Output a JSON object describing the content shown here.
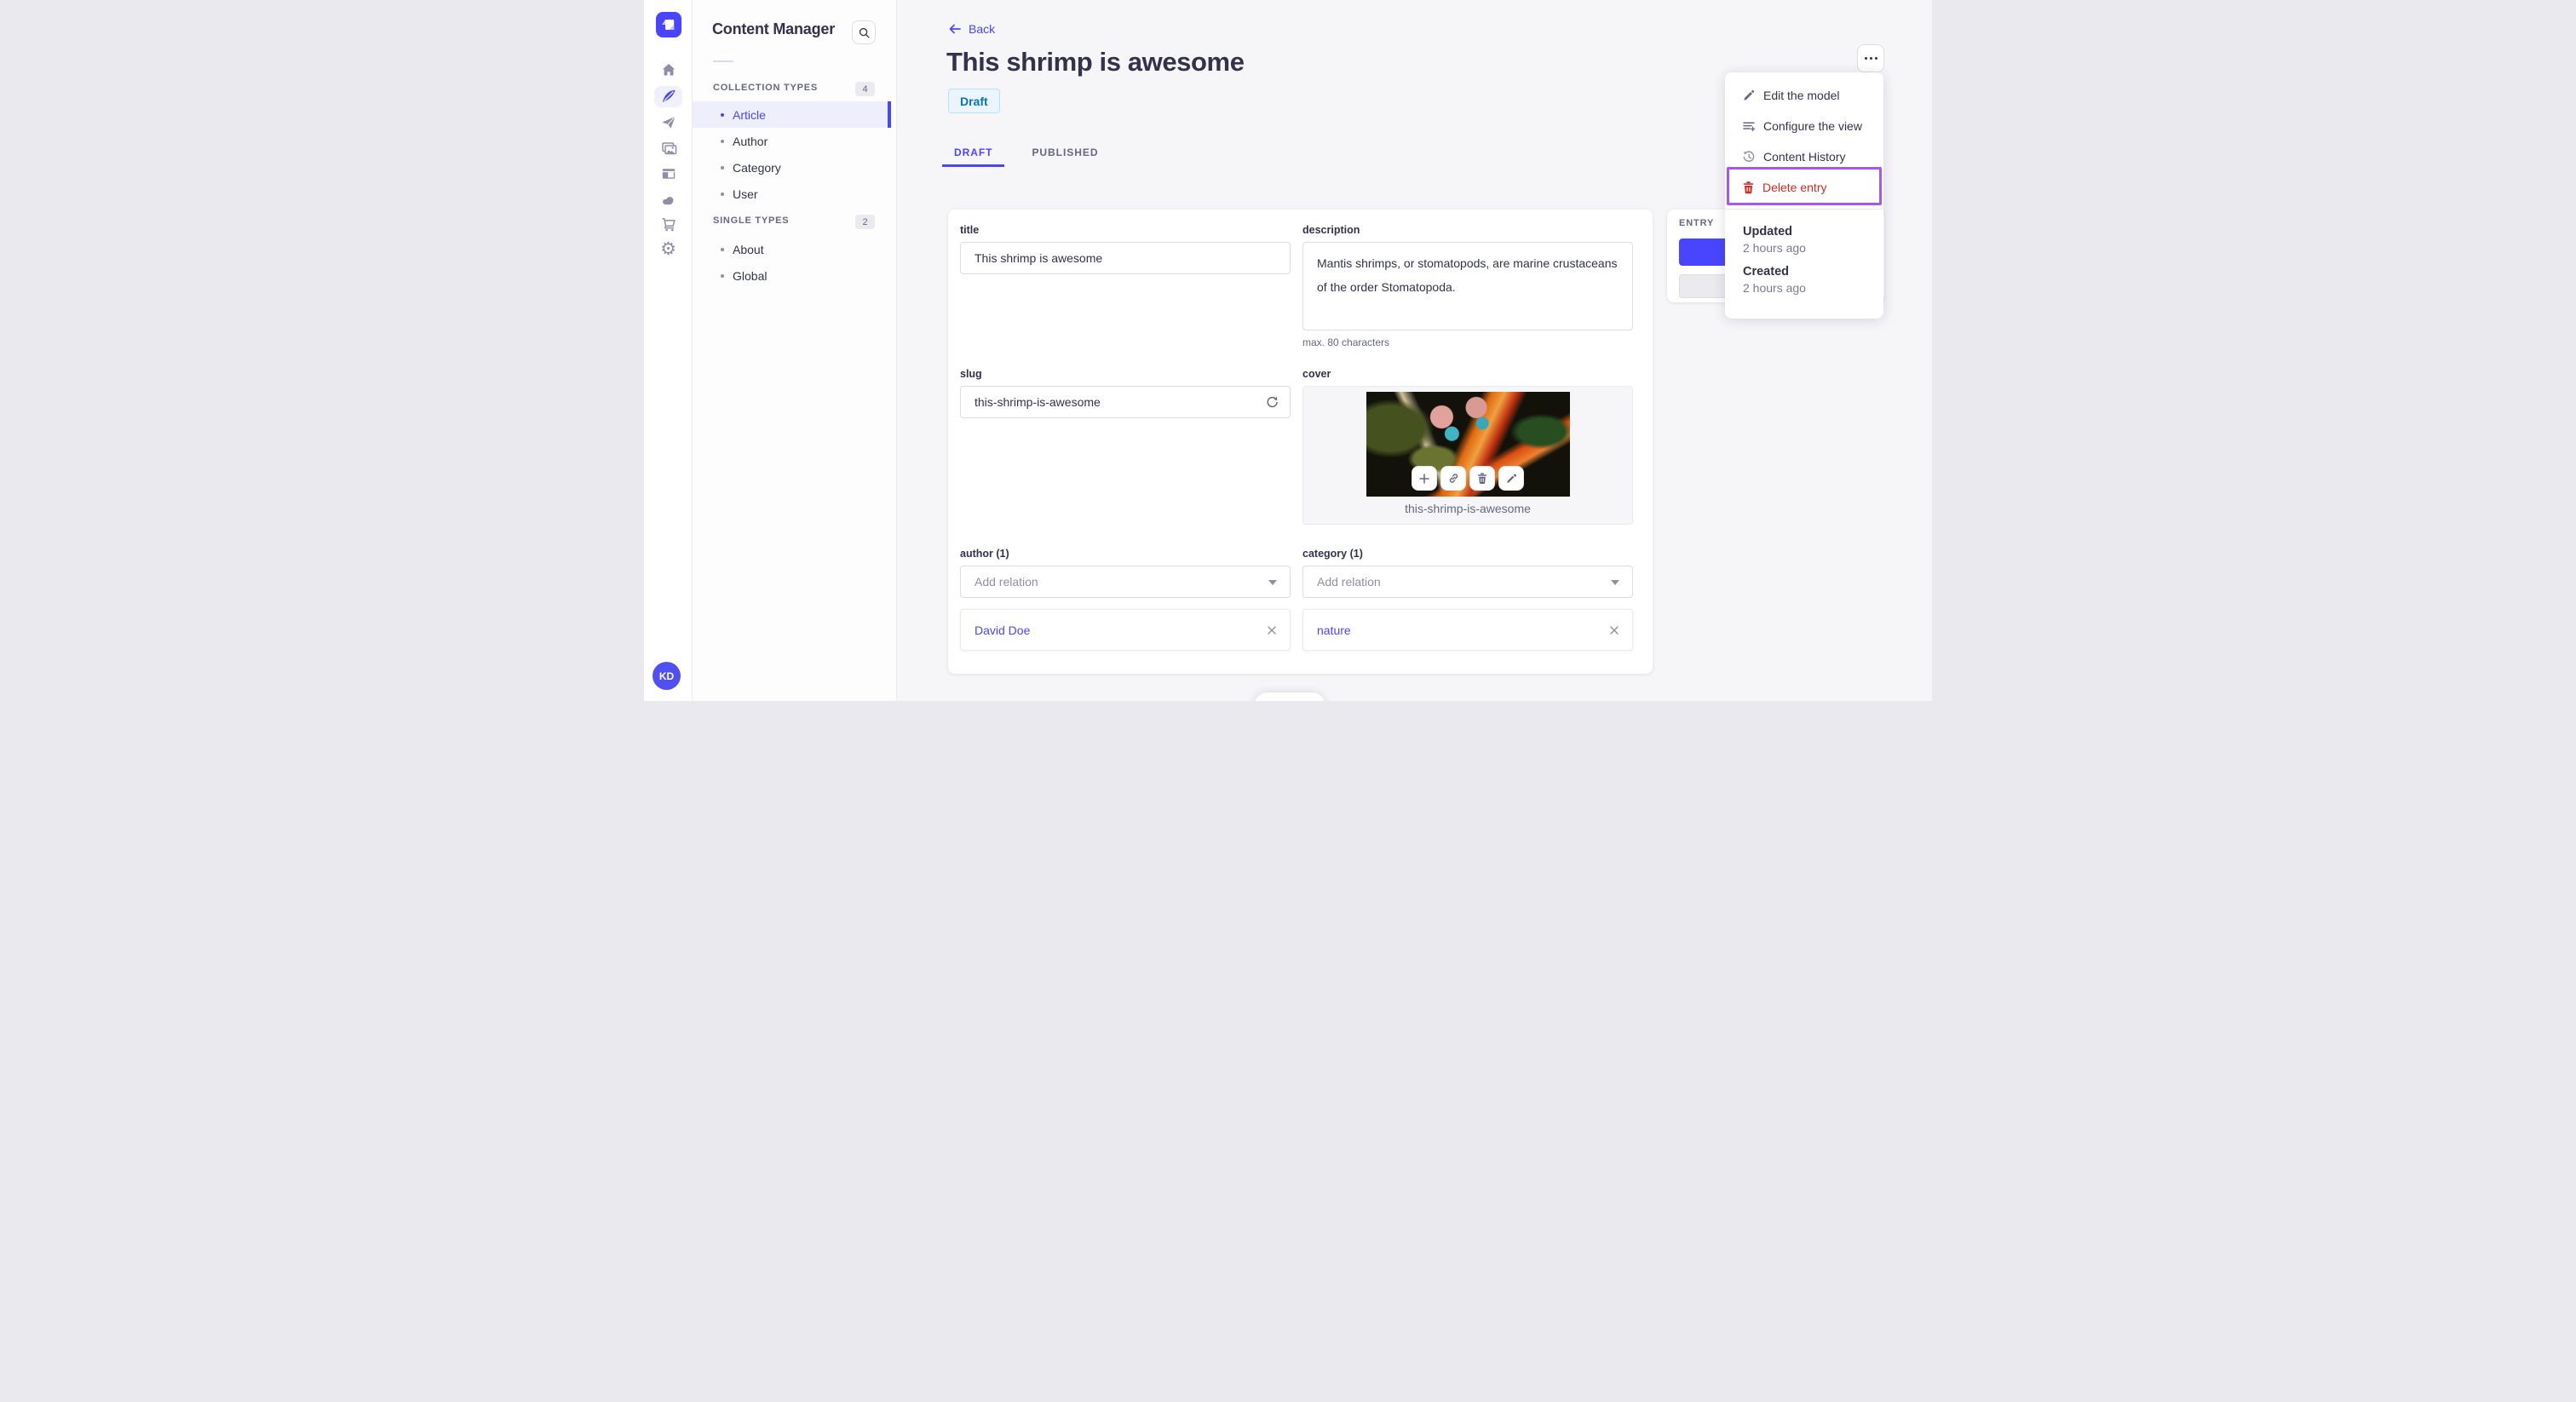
{
  "app": {
    "brand_icon": "strapi-logo"
  },
  "rail": {
    "icons": [
      "home-icon",
      "feather-icon",
      "paper-plane-icon",
      "media-icon",
      "layout-icon",
      "cloud-icon",
      "cart-icon",
      "gear-icon"
    ],
    "active_icon": "feather-icon",
    "avatar_initials": "KD"
  },
  "subnav": {
    "title": "Content Manager",
    "search_icon": "search-icon",
    "sections": [
      {
        "label": "COLLECTION TYPES",
        "badge": "4",
        "items": [
          {
            "label": "Article",
            "active": true
          },
          {
            "label": "Author",
            "active": false
          },
          {
            "label": "Category",
            "active": false
          },
          {
            "label": "User",
            "active": false
          }
        ]
      },
      {
        "label": "SINGLE TYPES",
        "badge": "2",
        "items": [
          {
            "label": "About",
            "active": false
          },
          {
            "label": "Global",
            "active": false
          }
        ]
      }
    ]
  },
  "header": {
    "back_label": "Back",
    "title": "This shrimp is awesome",
    "status": "Draft"
  },
  "tabs": [
    {
      "label": "DRAFT",
      "active": true
    },
    {
      "label": "PUBLISHED",
      "active": false
    }
  ],
  "form": {
    "title": {
      "label": "title",
      "value": "This shrimp is awesome"
    },
    "description": {
      "label": "description",
      "value": "Mantis shrimps, or stomatopods, are marine crustaceans of the order Stomatopoda.",
      "helper": "max. 80 characters"
    },
    "slug": {
      "label": "slug",
      "value": "this-shrimp-is-awesome",
      "action_icon": "refresh-icon"
    },
    "cover": {
      "label": "cover",
      "caption": "this-shrimp-is-awesome",
      "action_icons": [
        "plus-icon",
        "link-icon",
        "trash-icon",
        "pencil-icon"
      ]
    },
    "author": {
      "label": "author (1)",
      "placeholder": "Add relation",
      "relations": [
        "David Doe"
      ]
    },
    "category": {
      "label": "category (1)",
      "placeholder": "Add relation",
      "relations": [
        "nature"
      ]
    }
  },
  "entry_panel": {
    "label": "ENTRY"
  },
  "context_menu": {
    "trigger_icon": "ellipsis-icon",
    "items": [
      {
        "label": "Edit the model",
        "icon": "pencil-icon",
        "danger": false,
        "highlighted": false
      },
      {
        "label": "Configure the view",
        "icon": "configure-icon",
        "danger": false,
        "highlighted": false
      },
      {
        "label": "Content History",
        "icon": "history-icon",
        "danger": false,
        "highlighted": false
      },
      {
        "label": "Delete entry",
        "icon": "trash-icon",
        "danger": true,
        "highlighted": true
      }
    ],
    "meta": [
      {
        "label": "Updated",
        "value": "2 hours ago"
      },
      {
        "label": "Created",
        "value": "2 hours ago"
      }
    ]
  },
  "colors": {
    "primary": "#4945ff",
    "primary_bg": "#f0f0ff",
    "danger": "#d02b20",
    "annotation_highlight": "#a855f7",
    "draft_badge_bg": "#eaf5ff",
    "draft_badge_border": "#b8e1ff",
    "draft_badge_text": "#0c75af",
    "page_bg": "#f6f6f9"
  }
}
